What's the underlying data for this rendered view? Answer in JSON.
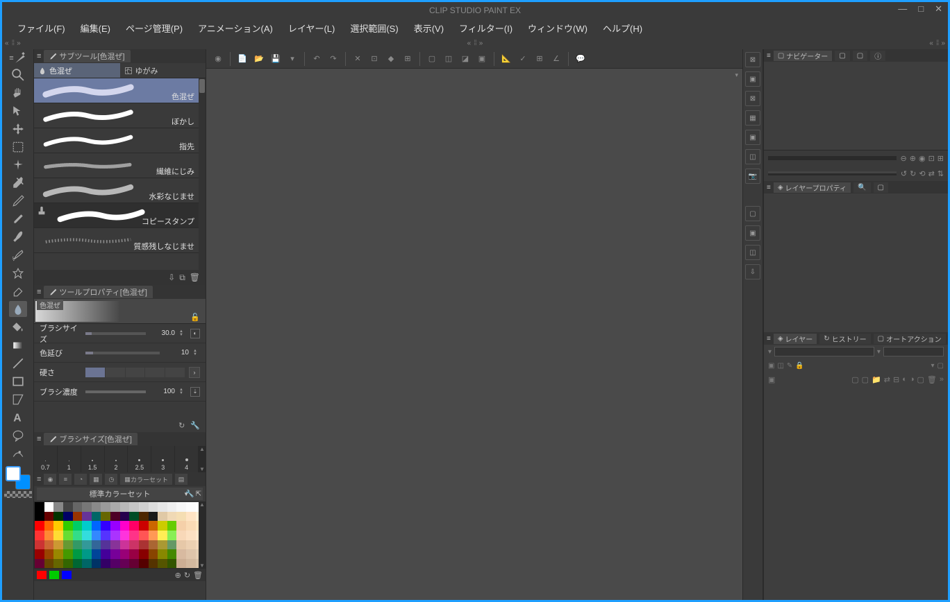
{
  "app": {
    "title": "CLIP STUDIO PAINT EX"
  },
  "menu": {
    "file": "ファイル(F)",
    "edit": "編集(E)",
    "page": "ページ管理(P)",
    "animation": "アニメーション(A)",
    "layer": "レイヤー(L)",
    "select": "選択範囲(S)",
    "view": "表示(V)",
    "filter": "フィルター(I)",
    "window": "ウィンドウ(W)",
    "help": "ヘルプ(H)"
  },
  "subtool_panel": {
    "title": "サブツール[色混ぜ]",
    "tab_blend": "色混ぜ",
    "tab_distort": "ゆがみ",
    "brushes": [
      {
        "label": "色混ぜ"
      },
      {
        "label": "ぼかし"
      },
      {
        "label": "指先"
      },
      {
        "label": "繊維にじみ"
      },
      {
        "label": "水彩なじませ"
      },
      {
        "label": "コピースタンプ"
      },
      {
        "label": "質感残しなじませ"
      }
    ]
  },
  "tool_property": {
    "title": "ツールプロパティ[色混ぜ]",
    "preview_label": "色混ぜ",
    "brush_size_label": "ブラシサイズ",
    "brush_size_value": "30.0",
    "color_extend_label": "色延び",
    "color_extend_value": "10",
    "hardness_label": "硬さ",
    "density_label": "ブラシ濃度",
    "density_value": "100"
  },
  "brush_size_panel": {
    "title": "ブラシサイズ[色混ぜ]",
    "sizes": [
      "0.7",
      "1",
      "1.5",
      "2",
      "2.5",
      "3",
      "4"
    ]
  },
  "color_set": {
    "tab_label": "カラーセット",
    "dropdown_label": "標準カラーセット",
    "grid_colors": [
      "#000000",
      "#ffffff",
      "#888888",
      "#444444",
      "#666666",
      "#777777",
      "#8a8a8a",
      "#9a9a9a",
      "#aaaaaa",
      "#b8b8b8",
      "#c4c4c4",
      "#d0d0d0",
      "#dcdcdc",
      "#e6e6e6",
      "#eeeeee",
      "#f6f6f6",
      "#fbfbfb",
      "#ffffff",
      "#000000",
      "#660000",
      "#003300",
      "#000066",
      "#993300",
      "#663399",
      "#006666",
      "#666600",
      "#4d0026",
      "#26004d",
      "#004d26",
      "#4d2600",
      "#1a1a1a",
      "#e0c9a6",
      "#f0d9b5",
      "#f5deb3",
      "#ffe4c4",
      "#ffefd5",
      "#ff0000",
      "#ff6600",
      "#ffcc00",
      "#33cc00",
      "#00cc66",
      "#00cccc",
      "#0066ff",
      "#3300ff",
      "#9900ff",
      "#ff00cc",
      "#ff0066",
      "#cc0000",
      "#cc6600",
      "#cccc00",
      "#66cc00",
      "#f5d0a9",
      "#fadbb5",
      "#ffe6c0",
      "#ff3333",
      "#ff8833",
      "#ffdd33",
      "#66dd33",
      "#33dd88",
      "#33dddd",
      "#3388ff",
      "#5533ff",
      "#aa33ff",
      "#ff33dd",
      "#ff3388",
      "#ff5555",
      "#ff9955",
      "#ffee55",
      "#88ee55",
      "#f8d8b8",
      "#fce0c2",
      "#ffe8cc",
      "#cc3333",
      "#cc6633",
      "#cc9933",
      "#669933",
      "#339966",
      "#339999",
      "#336699",
      "#553399",
      "#883399",
      "#cc3399",
      "#cc3366",
      "#aa3333",
      "#aa6633",
      "#aa9933",
      "#669966",
      "#e6c8a8",
      "#ecd0b2",
      "#f2d8bc",
      "#990000",
      "#994400",
      "#998800",
      "#449900",
      "#009944",
      "#009988",
      "#004499",
      "#440099",
      "#770099",
      "#990077",
      "#990044",
      "#880000",
      "#884400",
      "#888800",
      "#448800",
      "#d8baa0",
      "#dec4aa",
      "#e4ceb4",
      "#660033",
      "#664400",
      "#666600",
      "#336600",
      "#006633",
      "#006666",
      "#003366",
      "#330066",
      "#550066",
      "#660055",
      "#660033",
      "#550000",
      "#553300",
      "#555500",
      "#335500",
      "#ccae94",
      "#d2b89e",
      "#d8c2a8"
    ],
    "footer_swatches": [
      "#ff0000",
      "#00cc00",
      "#0000ff"
    ]
  },
  "right": {
    "navigator_title": "ナビゲーター",
    "layer_property_title": "レイヤープロパティ",
    "layer_title": "レイヤー",
    "history_title": "ヒストリー",
    "autoaction_title": "オートアクション"
  }
}
